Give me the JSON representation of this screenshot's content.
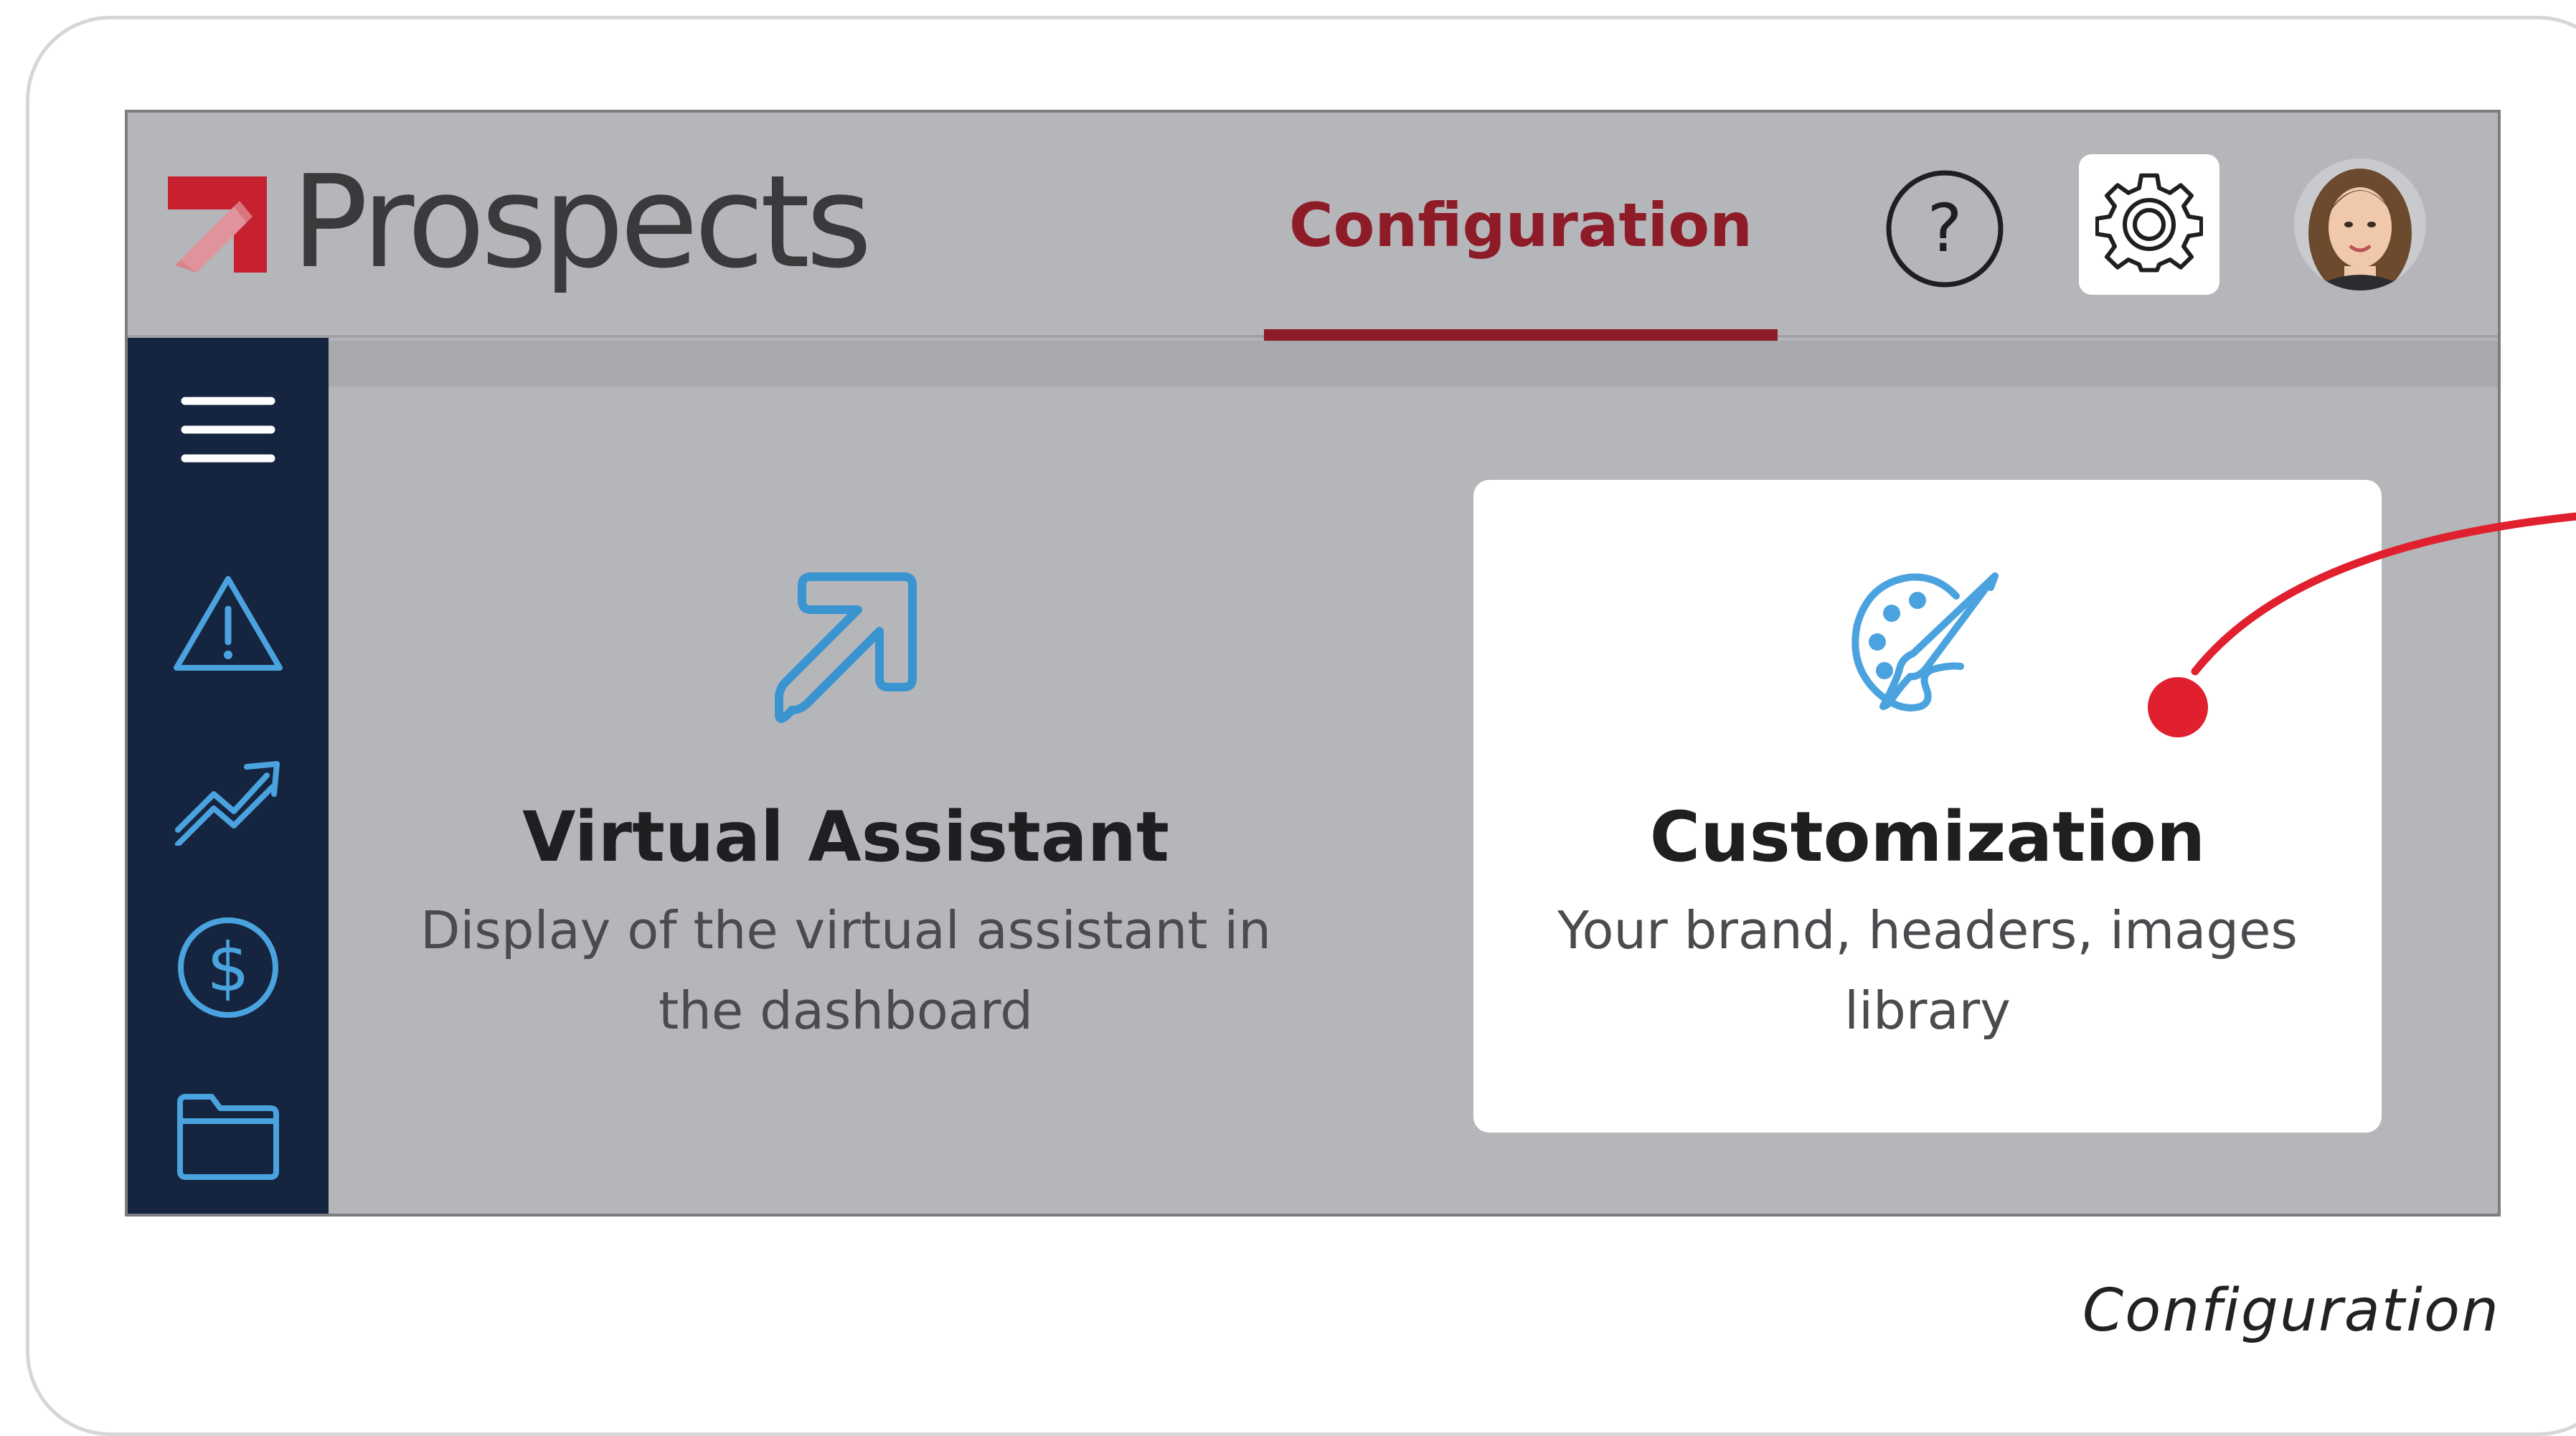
{
  "app": {
    "logo_text": "Prospects"
  },
  "header": {
    "active_tab": "Configuration",
    "help_label": "?",
    "accent_color": "#8e1b28"
  },
  "sidebar": {
    "background": "#15253f",
    "items": [
      {
        "icon": "menu-icon"
      },
      {
        "icon": "warning-icon"
      },
      {
        "icon": "trending-up-icon"
      },
      {
        "icon": "dollar-icon"
      },
      {
        "icon": "folder-icon"
      }
    ]
  },
  "cards": [
    {
      "icon": "arrow-up-right-icon",
      "title": "Virtual Assistant",
      "description": "Display of the virtual assistant in the dashboard",
      "highlighted": false
    },
    {
      "icon": "palette-icon",
      "title": "Customization",
      "description": "Your brand, headers, images library",
      "highlighted": true
    }
  ],
  "annotation": {
    "color": "#e0202e"
  },
  "caption": "Configuration"
}
